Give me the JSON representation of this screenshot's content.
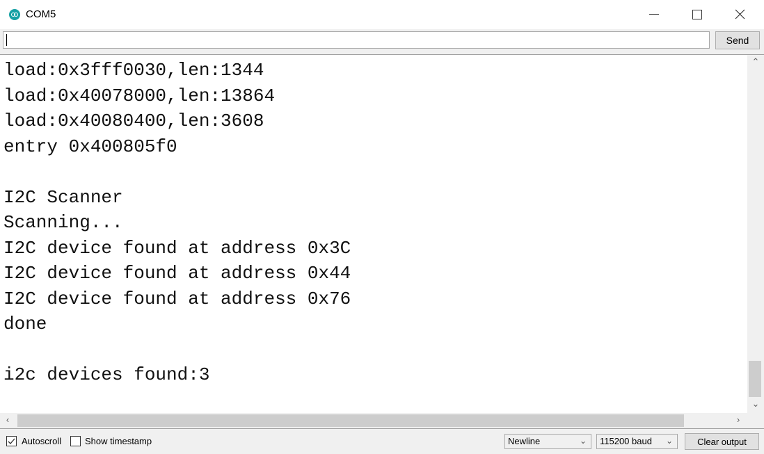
{
  "window": {
    "title": "COM5",
    "app_icon": "arduino-icon",
    "controls": [
      "minimize-icon",
      "maximize-icon",
      "close-icon"
    ]
  },
  "toolbar": {
    "input_value": "",
    "send_label": "Send"
  },
  "output": {
    "lines": [
      "load:0x3fff0030,len:1344",
      "load:0x40078000,len:13864",
      "load:0x40080400,len:3608",
      "entry 0x400805f0",
      "",
      "I2C Scanner",
      "Scanning...",
      "I2C device found at address 0x3C",
      "I2C device found at address 0x44",
      "I2C device found at address 0x76",
      "done",
      "",
      "i2c devices found:3"
    ]
  },
  "statusbar": {
    "autoscroll_label": "Autoscroll",
    "autoscroll_checked": true,
    "timestamp_label": "Show timestamp",
    "timestamp_checked": false,
    "line_ending": "Newline",
    "baud_rate": "115200 baud",
    "clear_label": "Clear output"
  },
  "colors": {
    "accent": "#17a1a5",
    "chrome_bg": "#f0f0f0",
    "button_bg": "#e1e1e1"
  }
}
